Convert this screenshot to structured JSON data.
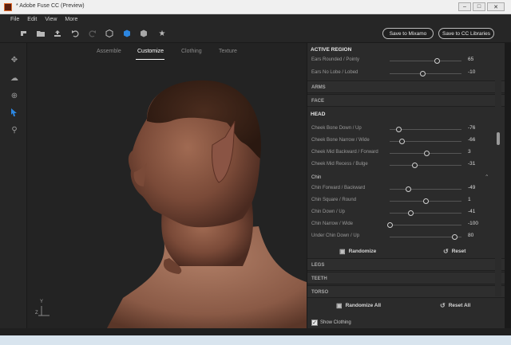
{
  "window": {
    "title": "* Adobe Fuse CC (Preview)",
    "minimize": "–",
    "maximize": "□",
    "close": "✕"
  },
  "menu": [
    "File",
    "Edit",
    "View",
    "More"
  ],
  "toolbar": {
    "save_mixamo": "Save to Mixamo",
    "save_cc": "Save to CC Libraries",
    "icons": [
      "cursor-icon",
      "folder-icon",
      "upload-icon",
      "undo-icon",
      "redo-icon",
      "cube-outline-icon",
      "cube-blue-icon",
      "cube-solid-icon",
      "star-icon"
    ]
  },
  "left_tools": [
    "move-icon",
    "orbit-icon",
    "target-icon",
    "select-icon",
    "pose-icon"
  ],
  "viewport_tabs": [
    "Assemble",
    "Customize",
    "Clothing",
    "Texture"
  ],
  "active_tab": "Customize",
  "axes": {
    "y": "Y",
    "z": "Z"
  },
  "panel": {
    "active_region": "ACTIVE REGION",
    "region_sliders": [
      {
        "label": "Ears Rounded / Pointy",
        "value": "65",
        "pos": 0.65
      },
      {
        "label": "Ears No Lobe / Lobed",
        "value": "-10",
        "pos": 0.45
      }
    ],
    "collapsed_top": [
      "ARMS",
      "FACE"
    ],
    "head": "HEAD",
    "head_sliders": [
      {
        "label": "Cheek Bone Down / Up",
        "value": "-76",
        "pos": 0.12
      },
      {
        "label": "Cheek Bone Narrow / Wide",
        "value": "-66",
        "pos": 0.17
      },
      {
        "label": "Cheek Mid Backward / Forward",
        "value": "3",
        "pos": 0.51
      },
      {
        "label": "Cheek Mid Recess / Bulge",
        "value": "-31",
        "pos": 0.34
      }
    ],
    "chin": "Chin",
    "chin_sliders": [
      {
        "label": "Chin Forward / Backward",
        "value": "-49",
        "pos": 0.25
      },
      {
        "label": "Chin Square / Round",
        "value": "1",
        "pos": 0.5
      },
      {
        "label": "Chin Down / Up",
        "value": "-41",
        "pos": 0.29
      },
      {
        "label": "Chin Narrow / Wide",
        "value": "-100",
        "pos": 0.0
      },
      {
        "label": "Under Chin Down / Up",
        "value": "80",
        "pos": 0.9
      }
    ],
    "randomize": "Randomize",
    "reset": "Reset",
    "collapsed_bottom": [
      "LEGS",
      "TEETH",
      "TORSO"
    ],
    "randomize_all": "Randomize All",
    "reset_all": "Reset All",
    "show_clothing": "Show Clothing",
    "show_clothing_checked": true
  }
}
